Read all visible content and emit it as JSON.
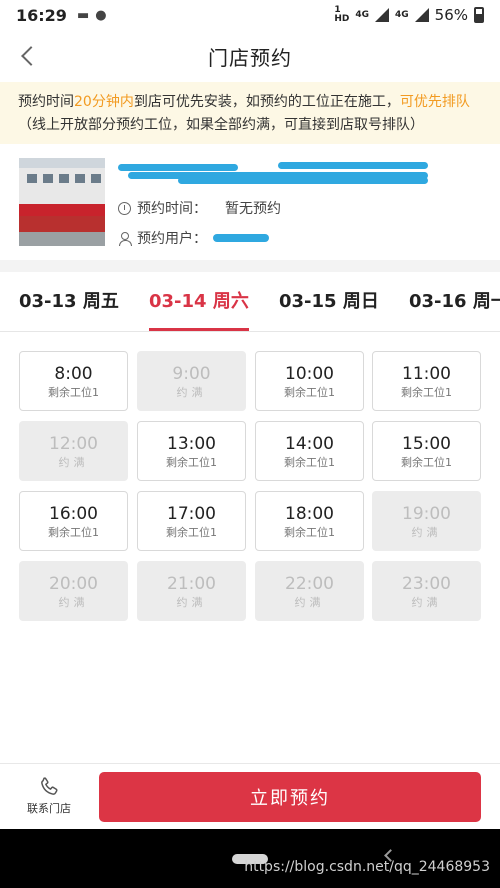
{
  "status_bar": {
    "time": "16:29",
    "indicators": [
      "message-icon",
      "wechat-icon"
    ],
    "sim_badge": "HD",
    "network_1": "4G",
    "network_2": "4G",
    "battery": "56%"
  },
  "header": {
    "title": "门店预约"
  },
  "notice": {
    "part1": "预约时间",
    "highlight1": "20分钟内",
    "part2": "到店可优先安装，如预约的工位正在施工，",
    "highlight2": "可优先排队",
    "part3": "（线上开放部分预约工位，如果全部约满，可直接到店取号排队）"
  },
  "store": {
    "booking_time_label": "预约时间：",
    "booking_time_value": "暂无预约",
    "booking_user_label": "预约用户："
  },
  "date_tabs": [
    {
      "label": "03-13 周五",
      "active": false
    },
    {
      "label": "03-14 周六",
      "active": true
    },
    {
      "label": "03-15 周日",
      "active": false
    },
    {
      "label": "03-16 周一",
      "active": false
    }
  ],
  "slots": [
    {
      "time": "8:00",
      "status": "剩余工位1",
      "full": false
    },
    {
      "time": "9:00",
      "status": "约满",
      "full": true
    },
    {
      "time": "10:00",
      "status": "剩余工位1",
      "full": false
    },
    {
      "time": "11:00",
      "status": "剩余工位1",
      "full": false
    },
    {
      "time": "12:00",
      "status": "约满",
      "full": true
    },
    {
      "time": "13:00",
      "status": "剩余工位1",
      "full": false
    },
    {
      "time": "14:00",
      "status": "剩余工位1",
      "full": false
    },
    {
      "time": "15:00",
      "status": "剩余工位1",
      "full": false
    },
    {
      "time": "16:00",
      "status": "剩余工位1",
      "full": false
    },
    {
      "time": "17:00",
      "status": "剩余工位1",
      "full": false
    },
    {
      "time": "18:00",
      "status": "剩余工位1",
      "full": false
    },
    {
      "time": "19:00",
      "status": "约满",
      "full": true
    },
    {
      "time": "20:00",
      "status": "约满",
      "full": true
    },
    {
      "time": "21:00",
      "status": "约满",
      "full": true
    },
    {
      "time": "22:00",
      "status": "约满",
      "full": true
    },
    {
      "time": "23:00",
      "status": "约满",
      "full": true
    }
  ],
  "bottom": {
    "contact_label": "联系门店",
    "book_label": "立即预约"
  },
  "watermark": "https://blog.csdn.net/qq_24468953",
  "colors": {
    "accent": "#dc3545",
    "highlight": "#f29b22",
    "notice_bg": "#fdf8e5"
  }
}
